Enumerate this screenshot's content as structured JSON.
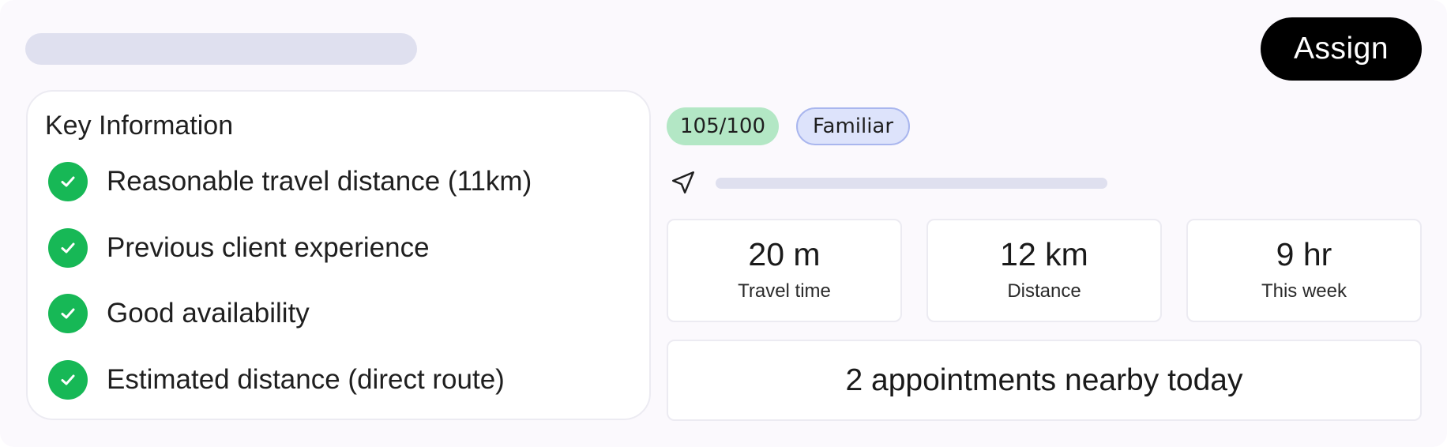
{
  "header": {
    "assign_label": "Assign"
  },
  "key_information": {
    "title": "Key Information",
    "reasons": [
      {
        "icon": "check-circle-icon",
        "text": "Reasonable travel distance (11km)"
      },
      {
        "icon": "check-circle-icon",
        "text": "Previous client experience"
      },
      {
        "icon": "check-circle-icon",
        "text": "Good availability"
      },
      {
        "icon": "check-circle-icon",
        "text": "Estimated distance (direct route)"
      }
    ]
  },
  "badges": {
    "score": "105/100",
    "familiarity": "Familiar"
  },
  "location": {
    "icon": "navigation-arrow-icon"
  },
  "stats": [
    {
      "value": "20 m",
      "label": "Travel time"
    },
    {
      "value": "12 km",
      "label": "Distance"
    },
    {
      "value": "9 hr",
      "label": "This week"
    }
  ],
  "nearby": {
    "text": "2 appointments nearby today"
  },
  "colors": {
    "check": "#17b856",
    "score_badge": "#b3e7c5",
    "familiar_badge": "#dde3fb",
    "familiar_border": "#a9b6ee",
    "skeleton": "#dfe0ef",
    "assign_button": "#000000"
  }
}
